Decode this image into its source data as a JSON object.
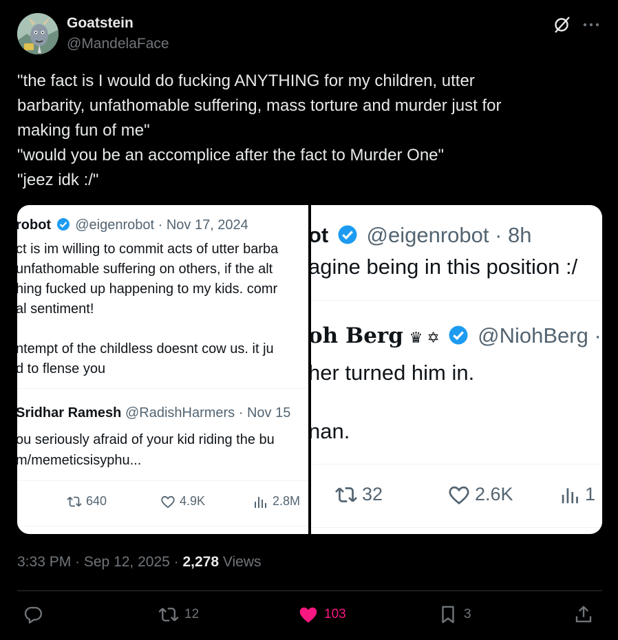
{
  "author": {
    "display_name": "Goatstein",
    "handle": "@MandelaFace",
    "avatar_icon": "goat-cartoon-avatar"
  },
  "post": {
    "lines": [
      "\"the fact is I would do fucking ANYTHING for my children, utter",
      "barbarity, unfathomable suffering, mass torture and murder just for",
      "making fun of me\"",
      "\"would you be an accomplice after the fact to Murder One\"",
      "\"jeez idk :/\""
    ]
  },
  "media": {
    "left": {
      "tweet1": {
        "name": "robot",
        "handle_date": "@eigenrobot · Nov 17, 2024",
        "lines": [
          "ct is im willing to commit acts of utter barba",
          "unfathomable suffering on others, if the alt",
          "hing fucked up happening to my kids. comr",
          "al sentiment!",
          "",
          "ntempt of the childless doesnt cow us. it ju",
          "d to flense you"
        ]
      },
      "tweet2": {
        "name": "Sridhar Ramesh",
        "handle_date": "@RadishHarmers · Nov 15",
        "lines": [
          "ou seriously afraid of your kid riding the bu",
          "m/memeticsisyphu..."
        ]
      },
      "actions": {
        "retweets": "640",
        "likes": "4.9K",
        "views": "2.8M"
      }
    },
    "right": {
      "tweet1": {
        "name": "ot",
        "handle_time": "@eigenrobot · 8h",
        "line": "agine being in this position :/"
      },
      "tweet2": {
        "name": "oh Berg",
        "badges": "♛ ✡",
        "handle": "@NiohBerg ·",
        "line1": "her turned him in.",
        "line2": "nan."
      },
      "actions": {
        "retweets": "32",
        "likes": "2.6K",
        "views": "1"
      }
    }
  },
  "meta": {
    "time_date": "3:33 PM · Sep 12, 2025 · ",
    "views_count": "2,278",
    "views_label": " Views"
  },
  "actions": {
    "replies": "",
    "reposts": "12",
    "likes": "103",
    "bookmarks": "3"
  },
  "colors": {
    "accent_like": "#f91880",
    "verified": "#1d9bf0",
    "muted": "#71767b"
  }
}
